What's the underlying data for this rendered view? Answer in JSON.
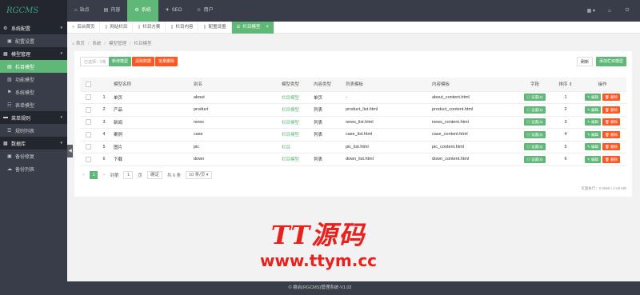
{
  "app": {
    "logo": "RGCMS"
  },
  "topnav": [
    {
      "icon": "home-icon",
      "glyph": "⌂",
      "label": "站点",
      "active": false
    },
    {
      "icon": "content-icon",
      "glyph": "▤",
      "label": "内容",
      "active": false
    },
    {
      "icon": "system-icon",
      "glyph": "⚙",
      "label": "系统",
      "active": true
    },
    {
      "icon": "seo-icon",
      "glyph": "✈",
      "label": "SEO",
      "active": false
    },
    {
      "icon": "user-icon",
      "glyph": "☺",
      "label": "用户",
      "active": false
    }
  ],
  "topright": {
    "theme_label": "▦ ▾",
    "bell": "♨",
    "power": "⏻"
  },
  "sidebar": [
    {
      "group": "系统配置",
      "icon": "gear-icon",
      "glyph": "⚙",
      "items": [
        {
          "label": "配置设置",
          "icon": "settings-icon",
          "glyph": "▣",
          "active": false
        }
      ]
    },
    {
      "group": "模型管理",
      "icon": "model-icon",
      "glyph": "▦",
      "items": [
        {
          "label": "栏目模型",
          "icon": "column-icon",
          "glyph": "▤",
          "active": true
        },
        {
          "label": "功能模型",
          "icon": "function-icon",
          "glyph": "▥",
          "active": false
        },
        {
          "label": "系统模型",
          "icon": "flag-icon",
          "glyph": "⚑",
          "active": false
        },
        {
          "label": "表单模型",
          "icon": "form-icon",
          "glyph": "☷",
          "active": false
        }
      ]
    },
    {
      "group": "菜单规则",
      "icon": "menu-icon",
      "glyph": "▬",
      "items": [
        {
          "label": "规则列表",
          "icon": "list-icon",
          "glyph": "☰",
          "active": false
        }
      ]
    },
    {
      "group": "数据库",
      "icon": "database-icon",
      "glyph": "▩",
      "items": [
        {
          "label": "备份修复",
          "icon": "repair-icon",
          "glyph": "▣",
          "active": false
        },
        {
          "label": "备份列表",
          "icon": "cloud-icon",
          "glyph": "☁",
          "active": false
        }
      ]
    }
  ],
  "collapse_glyph": "◀",
  "tabs": [
    {
      "label": "后台首页",
      "icon": "circle-icon",
      "glyph": "○",
      "active": false
    },
    {
      "label": "网站栏目",
      "icon": "doc-icon",
      "glyph": "▯",
      "active": false
    },
    {
      "label": "栏目方案",
      "icon": "doc-icon",
      "glyph": "▯",
      "active": false
    },
    {
      "label": "栏目内容",
      "icon": "doc-icon",
      "glyph": "▯",
      "active": false
    },
    {
      "label": "配置设置",
      "icon": "doc-icon",
      "glyph": "▯",
      "active": false
    },
    {
      "label": "栏目模型",
      "icon": "list-icon",
      "glyph": "☰",
      "active": true
    }
  ],
  "tab_close": "×",
  "breadcrumb": [
    "首页",
    "系统",
    "模型管理",
    "栏目模型"
  ],
  "breadcrumb_sep": "/",
  "toolbar": {
    "selected": "已选择：0条",
    "batch_edit": "新增模型",
    "clear_data": "清除数据",
    "batch_delete": "批量删除",
    "refresh": "刷新",
    "add_model": "添加栏目模型"
  },
  "table": {
    "headers": [
      "",
      "",
      "模型名称",
      "别名",
      "模型类型",
      "内容类型",
      "列表模板",
      "内容模板",
      "字段",
      "排序 ⇕",
      "操作"
    ],
    "field_btn": "▤ 设置(5)",
    "edit_btn": "✎ 编辑",
    "delete_btn": "🗑 删除",
    "rows": [
      {
        "id": "1",
        "name": "单页",
        "alias": "about",
        "type": "栏目模型",
        "ctype": "单页",
        "list_tpl": "-",
        "content_tpl": "about_content.html",
        "sort": "1"
      },
      {
        "id": "2",
        "name": "产品",
        "alias": "product",
        "type": "栏目模型",
        "ctype": "列表",
        "list_tpl": "product_list.html",
        "content_tpl": "product_content.html",
        "sort": "2"
      },
      {
        "id": "3",
        "name": "新闻",
        "alias": "news",
        "type": "栏目模型",
        "ctype": "列表",
        "list_tpl": "news_list.html",
        "content_tpl": "news_content.html",
        "sort": "3"
      },
      {
        "id": "4",
        "name": "案例",
        "alias": "case",
        "type": "栏目模型",
        "ctype": "列表",
        "list_tpl": "case_list.html",
        "content_tpl": "case_content.html",
        "sort": "4"
      },
      {
        "id": "5",
        "name": "图片",
        "alias": "pic",
        "type": "栏目",
        "ctype": "",
        "list_tpl": "pic_list.html",
        "content_tpl": "pic_content.html",
        "sort": "5"
      },
      {
        "id": "6",
        "name": "下载",
        "alias": "down",
        "type": "栏目模型",
        "ctype": "列表",
        "list_tpl": "down_list.html",
        "content_tpl": "down_content.html",
        "sort": "6"
      }
    ]
  },
  "pager": {
    "prev": "<",
    "current": "1",
    "next": ">",
    "to": "到第",
    "page_input": "1",
    "page_unit": "页",
    "go": "确定",
    "total": "共 6 条",
    "per_page": "10 条/页 ▾"
  },
  "runtime": "页面执行：0.0658 / 2.08 MB",
  "watermark": {
    "line1": "TT源码",
    "line2": "www.ttym.cc"
  },
  "footer": "© 睿启(RGCMS)管理系统-V1.02"
}
